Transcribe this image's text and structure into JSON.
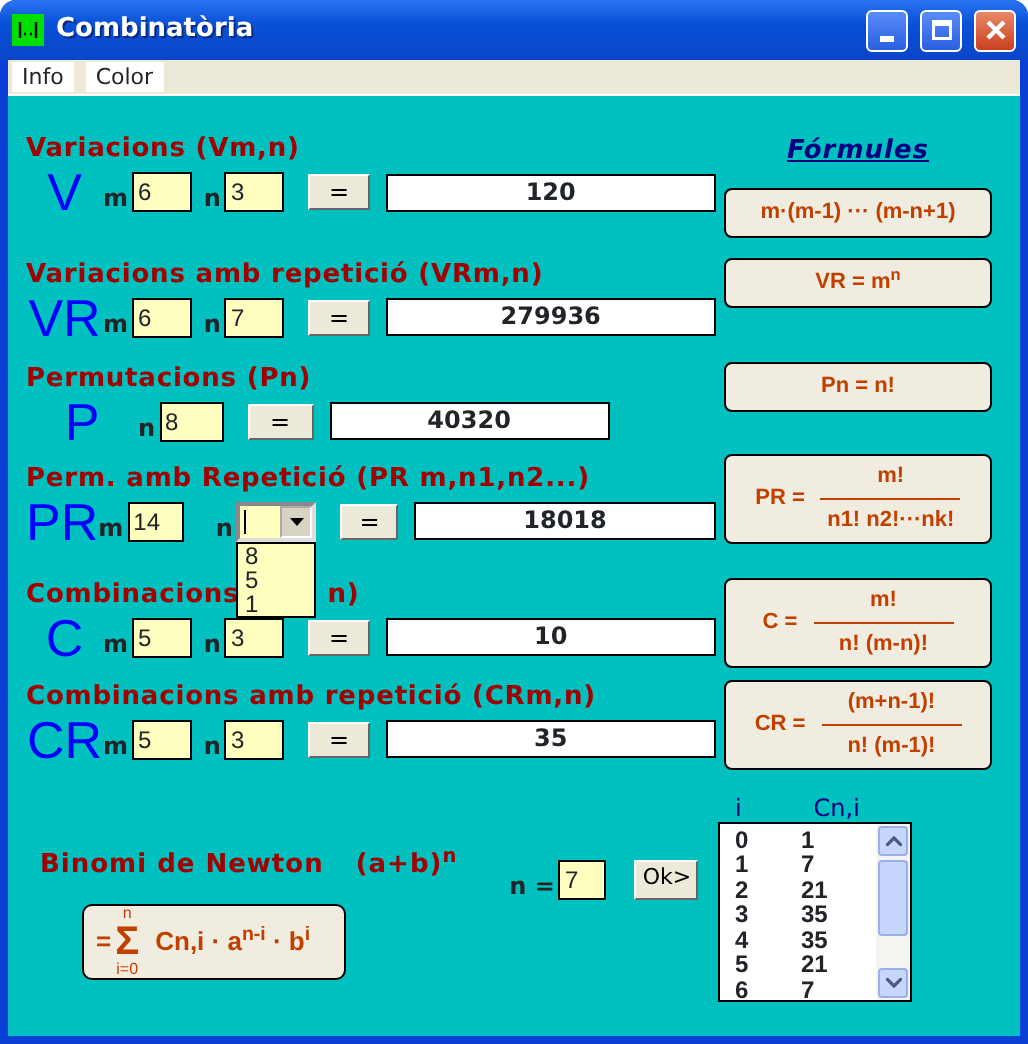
{
  "window": {
    "title": "Combinatòria"
  },
  "menu": [
    "Info",
    "Color"
  ],
  "formulas_heading": "Fórmules",
  "sections": [
    {
      "kind": "mn",
      "title": "Variacions (Vm,n)",
      "symbol": "V",
      "fields": [
        {
          "label": "m",
          "value": "6"
        },
        {
          "label": "n",
          "value": "3"
        }
      ],
      "button": "=",
      "result": "120",
      "formula": {
        "kind": "plain",
        "text": "m·(m-1) ··· (m-n+1)"
      }
    },
    {
      "kind": "mn",
      "title": "Variacions amb repetició (VRm,n)",
      "symbol": "VR",
      "fields": [
        {
          "label": "m",
          "value": "6"
        },
        {
          "label": "n",
          "value": "7"
        }
      ],
      "button": "=",
      "result": "279936",
      "formula": {
        "kind": "power",
        "text": "VR =  m",
        "exponent": "n"
      }
    },
    {
      "kind": "n",
      "title": "Permutacions (Pn)",
      "symbol": "P",
      "fields": [
        {
          "label": "n",
          "value": "8"
        }
      ],
      "button": "=",
      "result": "40320",
      "formula": {
        "kind": "plain",
        "text": "Pn = n!"
      }
    },
    {
      "kind": "combo",
      "title": "Perm. amb Repetició (PR m,n1,n2...)",
      "symbol": "PR",
      "fields": [
        {
          "label": "m",
          "value": "14"
        },
        {
          "label": "n",
          "expanded": true,
          "options": [
            "8",
            "5",
            "1"
          ]
        }
      ],
      "button": "=",
      "result": "18018",
      "formula": {
        "kind": "fraction",
        "text": "PR =",
        "numerator": "m!",
        "denominator": "n1! n2!···nk!"
      }
    },
    {
      "kind": "mn",
      "title": "Combinacions",
      "title_tail": "n)",
      "symbol": "C",
      "fields": [
        {
          "label": "m",
          "value": "5"
        },
        {
          "label": "n",
          "value": "3"
        }
      ],
      "button": "=",
      "result": "10",
      "formula": {
        "kind": "fraction",
        "text": "C =",
        "numerator": "m!",
        "denominator": "n! (m-n)!"
      }
    },
    {
      "kind": "mn",
      "title": "Combinacions amb repetició (CRm,n)",
      "symbol": "CR",
      "fields": [
        {
          "label": "m",
          "value": "5"
        },
        {
          "label": "n",
          "value": "3"
        }
      ],
      "button": "=",
      "result": "35",
      "formula": {
        "kind": "fraction",
        "text": "CR =",
        "numerator": "(m+n-1)!",
        "denominator": "n! (m-1)!"
      }
    }
  ],
  "binomial": {
    "title": "Binomi de Newton",
    "expression": "(a+b)$^{n}$",
    "formula": {
      "equals": "=",
      "sigma": "Σ",
      "upper": "n",
      "lower": "i=0",
      "term": "Cn,i · a$^{n-i}$ · b$^{i}$"
    },
    "n_label": "n =",
    "n_value": "7",
    "button": "Ok>",
    "list": {
      "columns": [
        "i",
        "Cn,i"
      ],
      "rows": [
        [
          "0",
          "1"
        ],
        [
          "1",
          "7"
        ],
        [
          "2",
          "21"
        ],
        [
          "3",
          "35"
        ],
        [
          "4",
          "35"
        ],
        [
          "5",
          "21"
        ],
        [
          "6",
          "7"
        ]
      ]
    }
  }
}
